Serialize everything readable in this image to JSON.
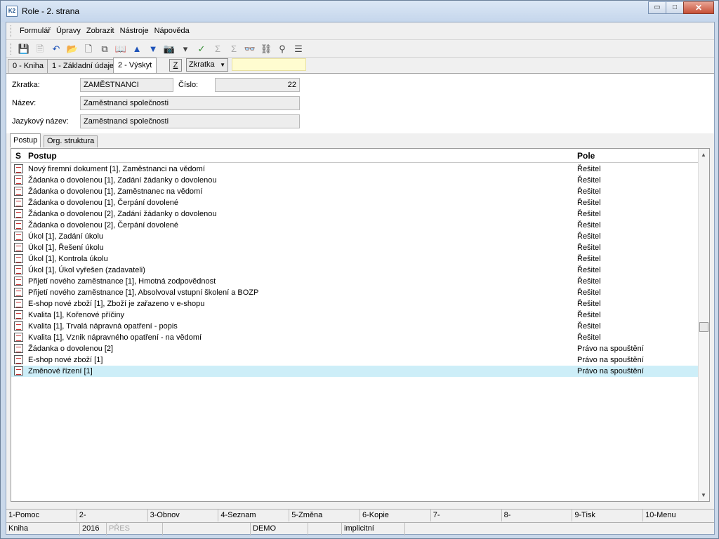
{
  "window": {
    "title": "Role - 2. strana",
    "app_icon": "K2",
    "minimize_glyph": "▭",
    "maximize_glyph": "□",
    "close_glyph": "✕"
  },
  "menu": [
    "Formulář",
    "Úpravy",
    "Zobrazit",
    "Nástroje",
    "Nápověda"
  ],
  "tabs": [
    "0 - Kniha",
    "1 - Základní údaje",
    "2 - Výskyt"
  ],
  "z_button": "Z",
  "combo": {
    "value": "Zkratka",
    "arrow": "▼"
  },
  "form": {
    "zkratka_label": "Zkratka:",
    "zkratka_value": "ZAMĚSTNANCI",
    "cislo_label": "Číslo:",
    "cislo_value": "22",
    "nazev_label": "Název:",
    "nazev_value": "Zaměstnanci společnosti",
    "jazyk_label": "Jazykový název:",
    "jazyk_value": "Zaměstnanci společnosti"
  },
  "subtabs": [
    "Postup",
    "Org. struktura"
  ],
  "grid": {
    "headers": {
      "s": "S",
      "postup": "Postup",
      "pole": "Pole"
    },
    "scroll_up": "▲",
    "scroll_down": "▼",
    "rows": [
      {
        "postup": "Nový firemní dokument [1], Zaměstnanci na vědomí",
        "pole": "Řešitel"
      },
      {
        "postup": "Žádanka o dovolenou [1], Zadání žádanky o dovolenou",
        "pole": "Řešitel"
      },
      {
        "postup": "Žádanka o dovolenou [1], Zaměstnanec na vědomí",
        "pole": "Řešitel"
      },
      {
        "postup": "Žádanka o dovolenou [1], Čerpání dovolené",
        "pole": "Řešitel"
      },
      {
        "postup": "Žádanka o dovolenou [2], Zadání žádanky o dovolenou",
        "pole": "Řešitel"
      },
      {
        "postup": "Žádanka o dovolenou [2], Čerpání dovolené",
        "pole": "Řešitel"
      },
      {
        "postup": "Úkol [1], Zadání úkolu",
        "pole": "Řešitel"
      },
      {
        "postup": "Úkol [1], Řešení úkolu",
        "pole": "Řešitel"
      },
      {
        "postup": "Úkol [1], Kontrola úkolu",
        "pole": "Řešitel"
      },
      {
        "postup": "Úkol [1], Úkol vyřešen (zadavateli)",
        "pole": "Řešitel"
      },
      {
        "postup": "Přijetí nového zaměstnance [1], Hmotná zodpovědnost",
        "pole": "Řešitel"
      },
      {
        "postup": "Přijetí nového zaměstnance [1], Absolvoval vstupní školení a BOZP",
        "pole": "Řešitel"
      },
      {
        "postup": "E-shop nové zboží [1], Zboží je zařazeno v e-shopu",
        "pole": "Řešitel"
      },
      {
        "postup": "Kvalita [1], Kořenové příčiny",
        "pole": "Řešitel"
      },
      {
        "postup": "Kvalita [1], Trvalá nápravná opatření - popis",
        "pole": "Řešitel"
      },
      {
        "postup": "Kvalita [1], Vznik nápravného opatření - na vědomí",
        "pole": "Řešitel"
      },
      {
        "postup": "Žádanka o dovolenou [2]",
        "pole": "Právo na spouštění"
      },
      {
        "postup": "E-shop nové zboží [1]",
        "pole": "Právo na spouštění"
      },
      {
        "postup": "Změnové řízení [1]",
        "pole": "Právo na spouštění"
      }
    ]
  },
  "fkeys": [
    "1-Pomoc",
    "2-",
    "3-Obnov",
    "4-Seznam",
    "5-Změna",
    "6-Kopie",
    "7-",
    "8-",
    "9-Tisk",
    "10-Menu"
  ],
  "status": {
    "s1": "Kniha",
    "s2": "2016",
    "s3": "PŘES",
    "s4": "DEMO",
    "s5": "implicitní"
  },
  "toolbar_icons": {
    "save": "💾",
    "save_all": "🗎",
    "undo": "↶",
    "open": "📂",
    "new": "🗋",
    "copy": "⧉",
    "book": "📖",
    "up": "▲",
    "down": "▼",
    "camera": "📷",
    "dropdown": "▾",
    "filter": "✓",
    "sum": "Σ",
    "sum2": "Σ",
    "binoculars": "👓",
    "binoculars2": "⛓",
    "find_next": "⚲",
    "menu": "☰"
  }
}
